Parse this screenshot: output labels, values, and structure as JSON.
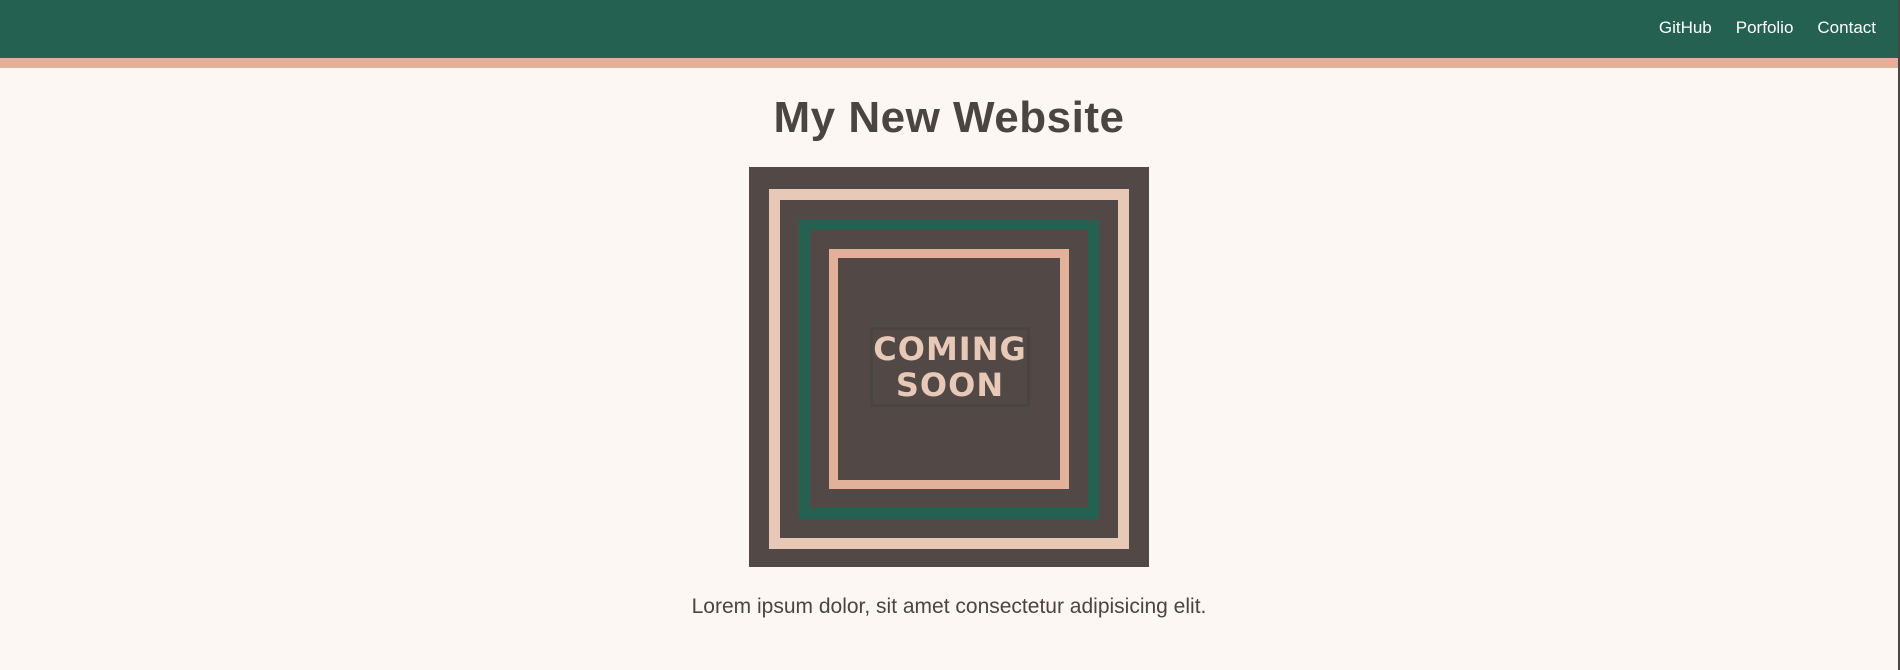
{
  "nav": {
    "items": [
      {
        "label": "GitHub"
      },
      {
        "label": "Porfolio"
      },
      {
        "label": "Contact"
      }
    ]
  },
  "main": {
    "title": "My New Website",
    "image_text": "COMING\nSOON",
    "description": "Lorem ipsum dolor, sit amet consectetur adipisicing elit."
  },
  "colors": {
    "header_bg": "#246150",
    "header_accent": "#e2b199",
    "page_bg": "#fdf7f3",
    "text": "#4a4442",
    "art_bg": "#524846",
    "art_light": "#e8c8b7"
  }
}
